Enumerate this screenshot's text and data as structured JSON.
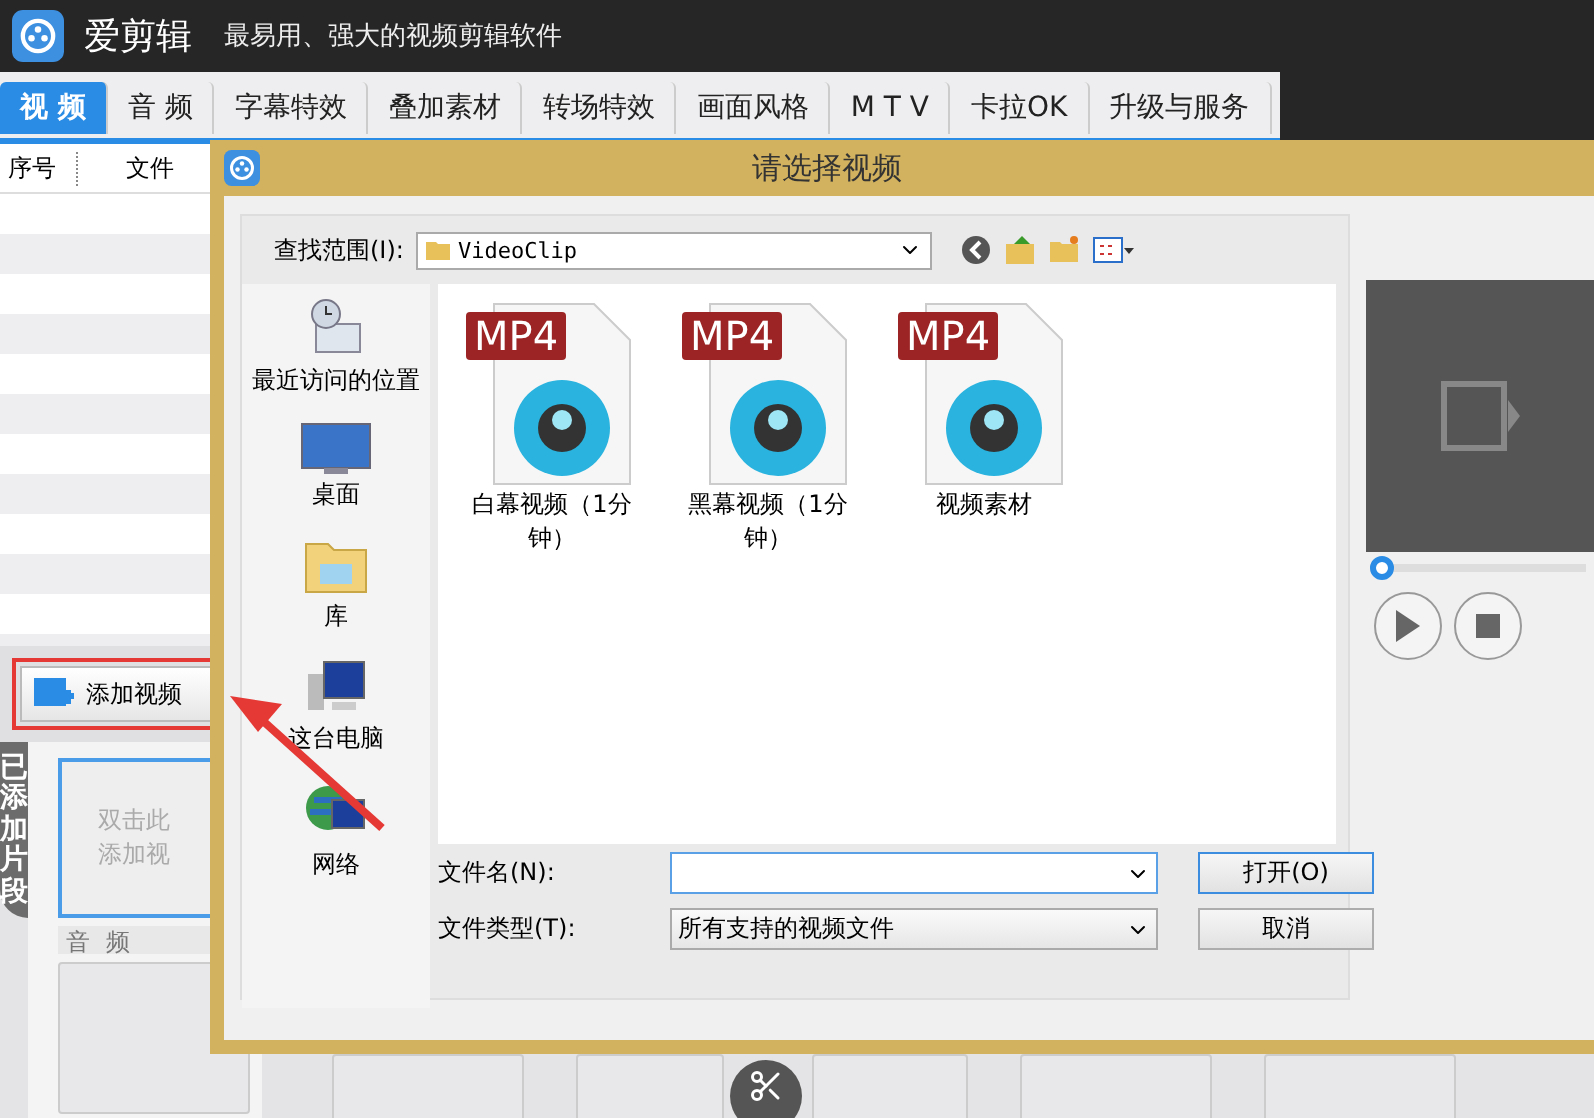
{
  "app": {
    "title": "爱剪辑",
    "slogan": "最易用、强大的视频剪辑软件"
  },
  "tabs": [
    {
      "label": "视 频",
      "selected": true
    },
    {
      "label": "音 频",
      "selected": false
    },
    {
      "label": "字幕特效",
      "selected": false
    },
    {
      "label": "叠加素材",
      "selected": false
    },
    {
      "label": "转场特效",
      "selected": false
    },
    {
      "label": "画面风格",
      "selected": false
    },
    {
      "label": "M T V",
      "selected": false
    },
    {
      "label": "卡拉OK",
      "selected": false
    },
    {
      "label": "升级与服务",
      "selected": false
    }
  ],
  "list": {
    "columns": [
      "序号",
      "文件"
    ]
  },
  "add_button": "添加视频",
  "side_tab": "已添加片段",
  "clip_hint": [
    "双击此",
    "添加视"
  ],
  "audio_label": "音 频",
  "dialog": {
    "title": "请选择视频",
    "look_in_label": "查找范围(I):",
    "folder": "VideoClip",
    "places": [
      {
        "kind": "recent",
        "label": "最近访问的位置"
      },
      {
        "kind": "desktop",
        "label": "桌面"
      },
      {
        "kind": "library",
        "label": "库"
      },
      {
        "kind": "computer",
        "label": "这台电脑"
      },
      {
        "kind": "network",
        "label": "网络"
      }
    ],
    "files": [
      {
        "badge": "MP4",
        "name": "白幕视频（1分钟）"
      },
      {
        "badge": "MP4",
        "name": "黑幕视频（1分钟）"
      },
      {
        "badge": "MP4",
        "name": "视频素材"
      }
    ],
    "filename_label": "文件名(N):",
    "filetype_label": "文件类型(T):",
    "filetype": "所有支持的视频文件",
    "open_button": "打开(O)",
    "cancel_button": "取消"
  },
  "preview": {
    "level": 0
  }
}
